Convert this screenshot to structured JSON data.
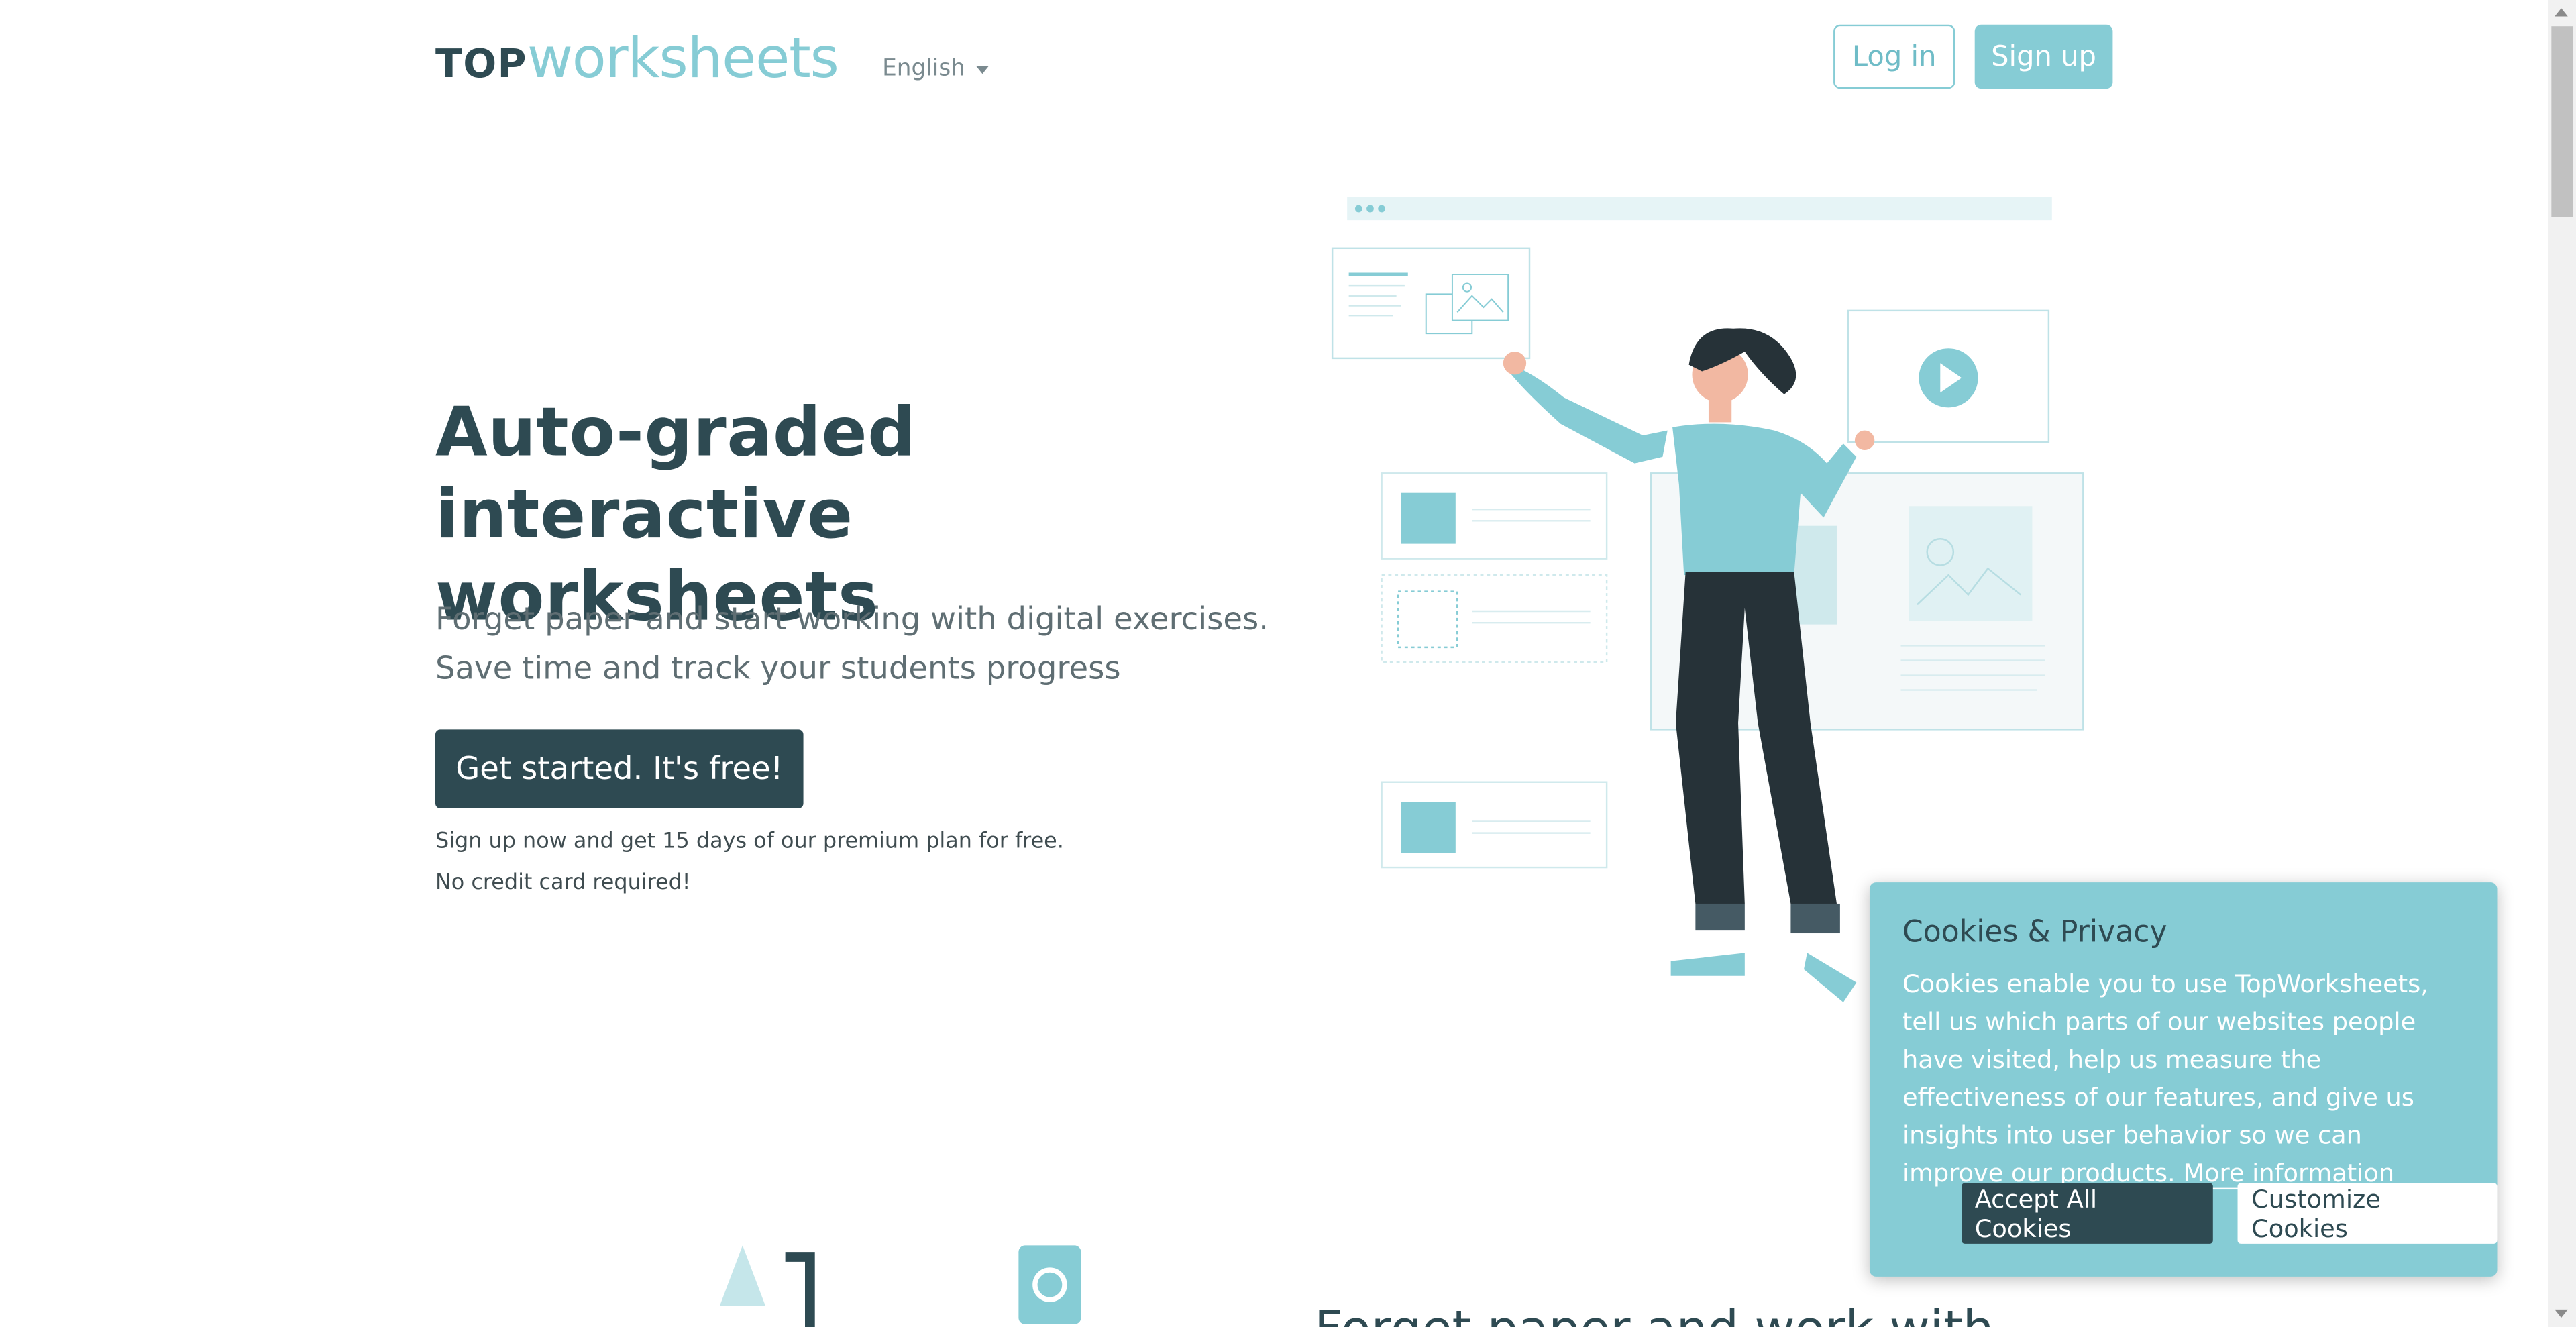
{
  "header": {
    "logo_top": "TOP",
    "logo_worksheets": "worksheets",
    "language": "English",
    "login_label": "Log in",
    "signup_label": "Sign up"
  },
  "hero": {
    "title": "Auto-graded interactive worksheets",
    "subtitle_line1": "Forget paper and start working with digital exercises.",
    "subtitle_line2": "Save time and track your students progress",
    "cta_label": "Get started. It's free!",
    "note_line1": "Sign up now and get 15 days of our premium plan for free.",
    "note_line2": "No credit card required!"
  },
  "teaser": {
    "text": "Forget paper and work with"
  },
  "cookies": {
    "title": "Cookies & Privacy",
    "body": "Cookies enable you to use TopWorksheets, tell us which parts of our websites people have visited, help us measure the effectiveness of our features, and give us insights into user behavior so we can improve our products.",
    "more_link": "More information",
    "accept_label": "Accept All Cookies",
    "customize_label": "Customize Cookies"
  },
  "colors": {
    "accent": "#86ccd5",
    "dark": "#2e4a52",
    "text_muted": "#5f6e73"
  },
  "icons": [
    "caret-down-icon",
    "play-icon",
    "image-icon",
    "rocket-icon",
    "gear-icon"
  ]
}
